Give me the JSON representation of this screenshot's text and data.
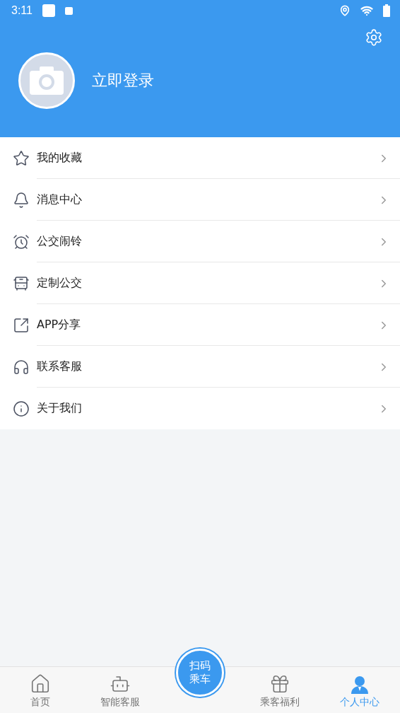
{
  "status_bar": {
    "time": "3:11"
  },
  "header": {
    "login_text": "立即登录"
  },
  "menu": [
    {
      "kind": "star",
      "label": "我的收藏"
    },
    {
      "kind": "bell",
      "label": "消息中心"
    },
    {
      "kind": "alarm",
      "label": "公交闹铃"
    },
    {
      "kind": "bus",
      "label": "定制公交"
    },
    {
      "kind": "share",
      "label": "APP分享"
    },
    {
      "kind": "headset",
      "label": "联系客服"
    },
    {
      "kind": "info",
      "label": "关于我们"
    }
  ],
  "scan_button": {
    "label": "扫码乘车"
  },
  "tabs": [
    {
      "kind": "home",
      "label": "首页",
      "selected": false
    },
    {
      "kind": "robot",
      "label": "智能客服",
      "selected": false
    },
    {
      "kind": "gift",
      "label": "乘客福利",
      "selected": false
    },
    {
      "kind": "user",
      "label": "个人中心",
      "selected": true
    }
  ]
}
